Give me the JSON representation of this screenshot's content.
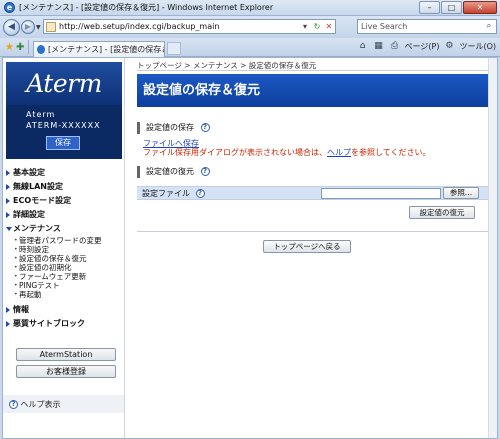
{
  "window": {
    "title": "[メンテナンス] - [設定値の保存＆復元] - Windows Internet Explorer",
    "minimize": "–",
    "maximize": "□",
    "close": "✕"
  },
  "browser": {
    "url": "http://web.setup/index.cgi/backup_main",
    "search_placeholder": "Live Search",
    "tab_label": "[メンテナンス] - [設定値の保存＆復...",
    "page_menu": "ページ(P)",
    "tools_menu": "ツール(O)"
  },
  "sidebar": {
    "logo": "Aterm",
    "model_line1": "Aterm ",
    "model_line2": "ATERM-XXXXXX",
    "save_button": "保存",
    "menu": [
      {
        "label": "基本設定"
      },
      {
        "label": "無線LAN設定"
      },
      {
        "label": "ECOモード設定"
      },
      {
        "label": "詳細設定"
      },
      {
        "label": "メンテナンス"
      }
    ],
    "maintenance_items": [
      "管理者パスワードの変更",
      "時刻設定",
      "設定値の保存＆復元",
      "設定値の初期化",
      "ファームウェア更新",
      "PINGテスト",
      "再起動"
    ],
    "menu_after": [
      {
        "label": "情報"
      },
      {
        "label": "悪質サイトブロック"
      }
    ],
    "aterm_station_button": "AtermStation",
    "register_button": "お客様登録",
    "help_display": "ヘルプ表示"
  },
  "main": {
    "breadcrumb": "トップページ > メンテナンス > 設定値の保存＆復元",
    "page_title": "設定値の保存＆復元",
    "save_section_title": "設定値の保存",
    "save_link": "ファイルへ保存",
    "save_note_prefix": "ファイル保存用ダイアログが表示されない場合は、",
    "save_note_help": "ヘルプ",
    "save_note_suffix": "を参照してください。",
    "restore_section_title": "設定値の復元",
    "config_file_label": "設定ファイル",
    "browse_button": "参照...",
    "restore_button": "設定値の復元",
    "top_page_button": "トップページへ戻る"
  }
}
